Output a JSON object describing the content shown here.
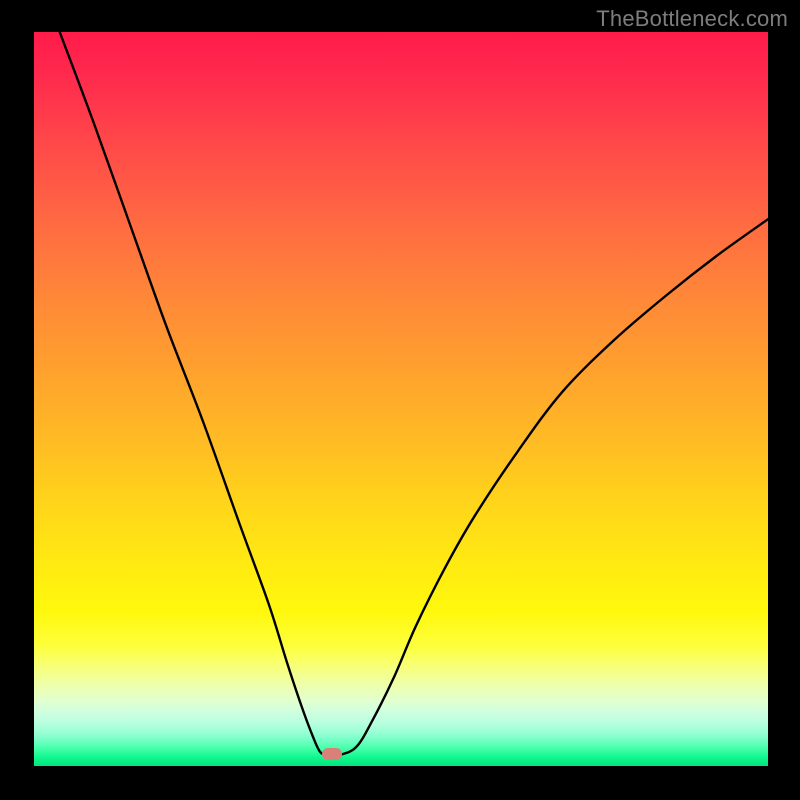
{
  "watermark": "TheBottleneck.com",
  "marker": {
    "x_frac": 0.406,
    "y_frac": 0.984
  },
  "chart_data": {
    "type": "line",
    "title": "",
    "xlabel": "",
    "ylabel": "",
    "xlim": [
      0,
      1
    ],
    "ylim": [
      0,
      1
    ],
    "series": [
      {
        "name": "bottleneck-curve",
        "x": [
          0.035,
          0.08,
          0.13,
          0.18,
          0.23,
          0.28,
          0.32,
          0.345,
          0.365,
          0.38,
          0.39,
          0.4,
          0.42,
          0.44,
          0.46,
          0.49,
          0.52,
          0.56,
          0.6,
          0.66,
          0.72,
          0.79,
          0.86,
          0.93,
          1.0
        ],
        "y": [
          1.0,
          0.88,
          0.74,
          0.6,
          0.47,
          0.33,
          0.22,
          0.14,
          0.08,
          0.04,
          0.019,
          0.016,
          0.016,
          0.027,
          0.06,
          0.12,
          0.19,
          0.27,
          0.34,
          0.43,
          0.51,
          0.58,
          0.64,
          0.695,
          0.745
        ]
      }
    ],
    "annotations": [
      {
        "type": "marker",
        "x": 0.406,
        "y": 0.016,
        "color": "#d98079"
      }
    ],
    "background_gradient": [
      "#ff1b4a",
      "#ffe912",
      "#01e57d"
    ]
  }
}
